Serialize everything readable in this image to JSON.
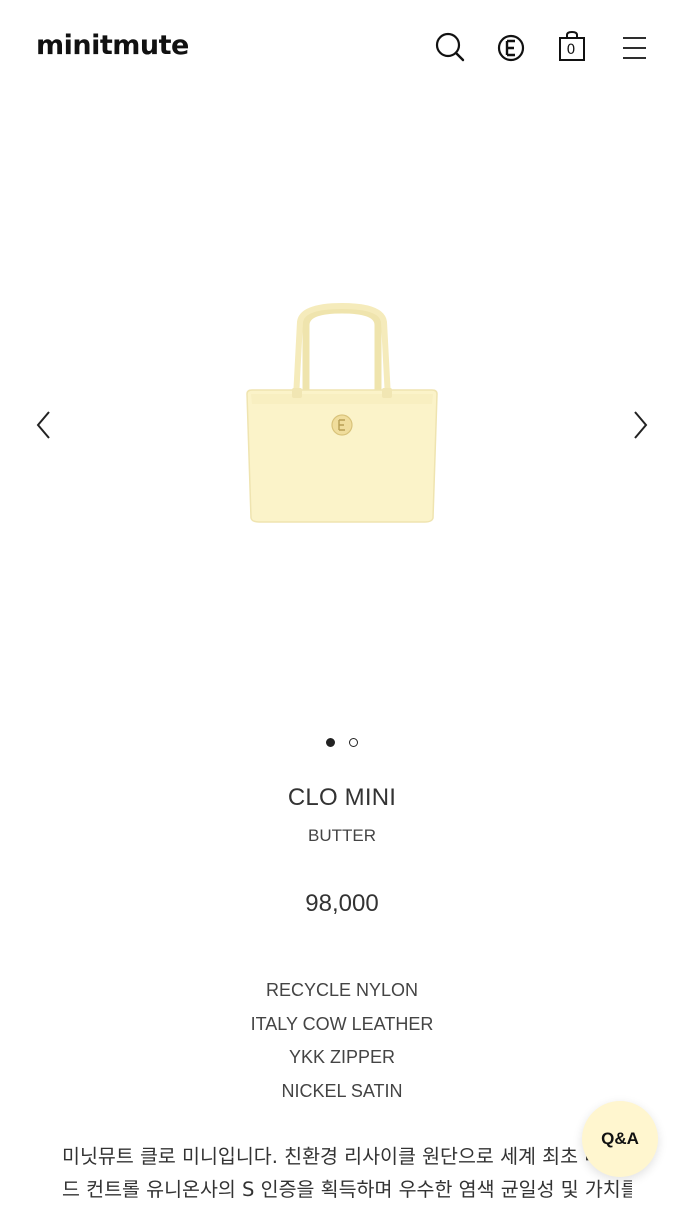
{
  "header": {
    "logo": "minitmute",
    "cart_count": "0"
  },
  "carousel": {
    "slide_count": 2,
    "active_index": 0
  },
  "product": {
    "name": "CLO MINI",
    "color": "BUTTER",
    "price": "98,000",
    "materials": [
      "RECYCLE NYLON",
      "ITALY COW LEATHER",
      "YKK ZIPPER",
      "NICKEL SATIN"
    ],
    "description_lines": [
      "미닛뮤트 클로 미니입니다. 친환경 리사이클 원단으로 세계 최초 네",
      "드 컨트롤 유니온사의 S 인증을 획득하며 우수한 염색 균일성 및 가치를"
    ]
  },
  "qa_button": {
    "label": "Q&A"
  },
  "colors": {
    "bag_body": "#fbf3c9",
    "qa_background": "#fff6cf",
    "text": "#333333"
  }
}
